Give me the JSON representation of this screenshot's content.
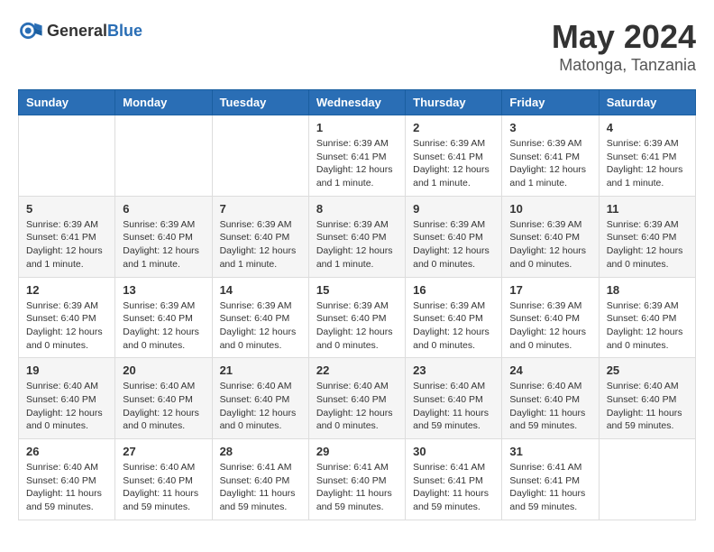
{
  "logo": {
    "text_general": "General",
    "text_blue": "Blue"
  },
  "header": {
    "month_year": "May 2024",
    "location": "Matonga, Tanzania"
  },
  "weekdays": [
    "Sunday",
    "Monday",
    "Tuesday",
    "Wednesday",
    "Thursday",
    "Friday",
    "Saturday"
  ],
  "weeks": [
    [
      {
        "day": "",
        "info": ""
      },
      {
        "day": "",
        "info": ""
      },
      {
        "day": "",
        "info": ""
      },
      {
        "day": "1",
        "info": "Sunrise: 6:39 AM\nSunset: 6:41 PM\nDaylight: 12 hours\nand 1 minute."
      },
      {
        "day": "2",
        "info": "Sunrise: 6:39 AM\nSunset: 6:41 PM\nDaylight: 12 hours\nand 1 minute."
      },
      {
        "day": "3",
        "info": "Sunrise: 6:39 AM\nSunset: 6:41 PM\nDaylight: 12 hours\nand 1 minute."
      },
      {
        "day": "4",
        "info": "Sunrise: 6:39 AM\nSunset: 6:41 PM\nDaylight: 12 hours\nand 1 minute."
      }
    ],
    [
      {
        "day": "5",
        "info": "Sunrise: 6:39 AM\nSunset: 6:41 PM\nDaylight: 12 hours\nand 1 minute."
      },
      {
        "day": "6",
        "info": "Sunrise: 6:39 AM\nSunset: 6:40 PM\nDaylight: 12 hours\nand 1 minute."
      },
      {
        "day": "7",
        "info": "Sunrise: 6:39 AM\nSunset: 6:40 PM\nDaylight: 12 hours\nand 1 minute."
      },
      {
        "day": "8",
        "info": "Sunrise: 6:39 AM\nSunset: 6:40 PM\nDaylight: 12 hours\nand 1 minute."
      },
      {
        "day": "9",
        "info": "Sunrise: 6:39 AM\nSunset: 6:40 PM\nDaylight: 12 hours\nand 0 minutes."
      },
      {
        "day": "10",
        "info": "Sunrise: 6:39 AM\nSunset: 6:40 PM\nDaylight: 12 hours\nand 0 minutes."
      },
      {
        "day": "11",
        "info": "Sunrise: 6:39 AM\nSunset: 6:40 PM\nDaylight: 12 hours\nand 0 minutes."
      }
    ],
    [
      {
        "day": "12",
        "info": "Sunrise: 6:39 AM\nSunset: 6:40 PM\nDaylight: 12 hours\nand 0 minutes."
      },
      {
        "day": "13",
        "info": "Sunrise: 6:39 AM\nSunset: 6:40 PM\nDaylight: 12 hours\nand 0 minutes."
      },
      {
        "day": "14",
        "info": "Sunrise: 6:39 AM\nSunset: 6:40 PM\nDaylight: 12 hours\nand 0 minutes."
      },
      {
        "day": "15",
        "info": "Sunrise: 6:39 AM\nSunset: 6:40 PM\nDaylight: 12 hours\nand 0 minutes."
      },
      {
        "day": "16",
        "info": "Sunrise: 6:39 AM\nSunset: 6:40 PM\nDaylight: 12 hours\nand 0 minutes."
      },
      {
        "day": "17",
        "info": "Sunrise: 6:39 AM\nSunset: 6:40 PM\nDaylight: 12 hours\nand 0 minutes."
      },
      {
        "day": "18",
        "info": "Sunrise: 6:39 AM\nSunset: 6:40 PM\nDaylight: 12 hours\nand 0 minutes."
      }
    ],
    [
      {
        "day": "19",
        "info": "Sunrise: 6:40 AM\nSunset: 6:40 PM\nDaylight: 12 hours\nand 0 minutes."
      },
      {
        "day": "20",
        "info": "Sunrise: 6:40 AM\nSunset: 6:40 PM\nDaylight: 12 hours\nand 0 minutes."
      },
      {
        "day": "21",
        "info": "Sunrise: 6:40 AM\nSunset: 6:40 PM\nDaylight: 12 hours\nand 0 minutes."
      },
      {
        "day": "22",
        "info": "Sunrise: 6:40 AM\nSunset: 6:40 PM\nDaylight: 12 hours\nand 0 minutes."
      },
      {
        "day": "23",
        "info": "Sunrise: 6:40 AM\nSunset: 6:40 PM\nDaylight: 11 hours\nand 59 minutes."
      },
      {
        "day": "24",
        "info": "Sunrise: 6:40 AM\nSunset: 6:40 PM\nDaylight: 11 hours\nand 59 minutes."
      },
      {
        "day": "25",
        "info": "Sunrise: 6:40 AM\nSunset: 6:40 PM\nDaylight: 11 hours\nand 59 minutes."
      }
    ],
    [
      {
        "day": "26",
        "info": "Sunrise: 6:40 AM\nSunset: 6:40 PM\nDaylight: 11 hours\nand 59 minutes."
      },
      {
        "day": "27",
        "info": "Sunrise: 6:40 AM\nSunset: 6:40 PM\nDaylight: 11 hours\nand 59 minutes."
      },
      {
        "day": "28",
        "info": "Sunrise: 6:41 AM\nSunset: 6:40 PM\nDaylight: 11 hours\nand 59 minutes."
      },
      {
        "day": "29",
        "info": "Sunrise: 6:41 AM\nSunset: 6:40 PM\nDaylight: 11 hours\nand 59 minutes."
      },
      {
        "day": "30",
        "info": "Sunrise: 6:41 AM\nSunset: 6:41 PM\nDaylight: 11 hours\nand 59 minutes."
      },
      {
        "day": "31",
        "info": "Sunrise: 6:41 AM\nSunset: 6:41 PM\nDaylight: 11 hours\nand 59 minutes."
      },
      {
        "day": "",
        "info": ""
      }
    ]
  ]
}
